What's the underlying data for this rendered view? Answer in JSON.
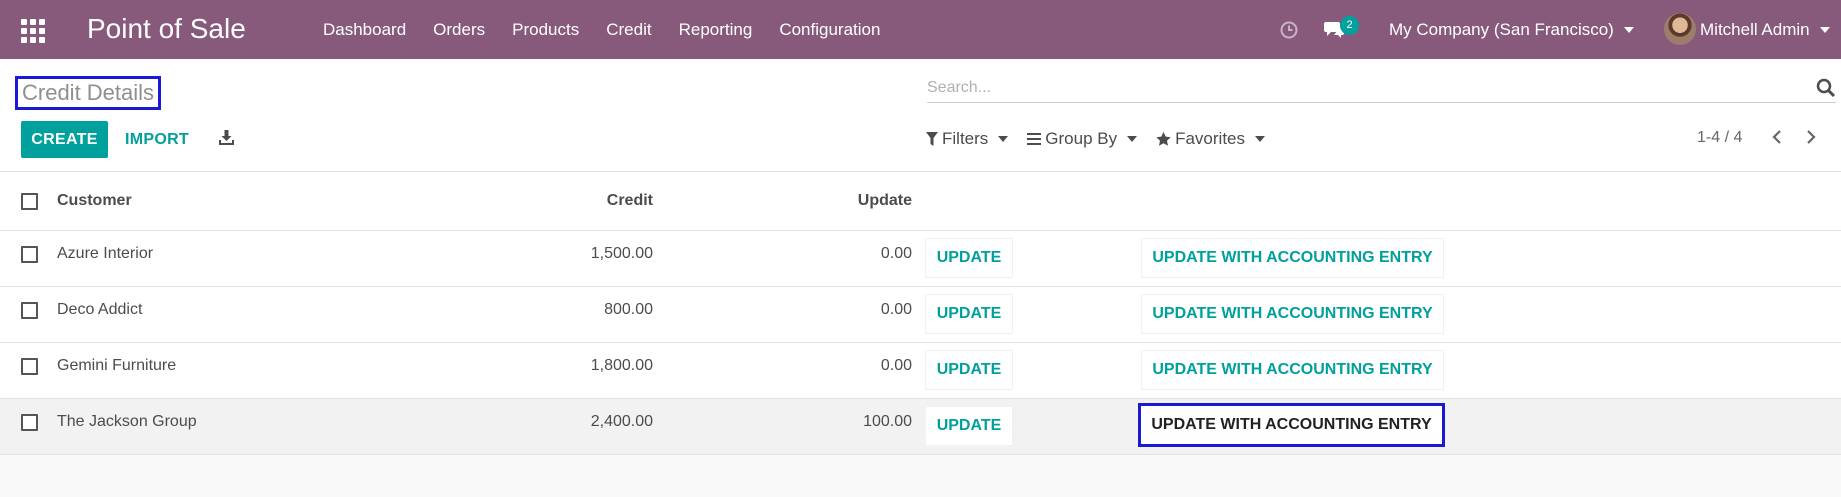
{
  "navbar": {
    "app_title": "Point of Sale",
    "menu": [
      "Dashboard",
      "Orders",
      "Products",
      "Credit",
      "Reporting",
      "Configuration"
    ],
    "chat_count": "2",
    "company": "My Company (San Francisco)",
    "user": "Mitchell Admin"
  },
  "control_panel": {
    "breadcrumb": "Credit Details",
    "search_placeholder": "Search...",
    "create_label": "CREATE",
    "import_label": "IMPORT",
    "filters_label": "Filters",
    "groupby_label": "Group By",
    "favorites_label": "Favorites",
    "pager": "1-4 / 4"
  },
  "table": {
    "headers": {
      "customer": "Customer",
      "credit": "Credit",
      "update": "Update"
    },
    "update_button": "UPDATE",
    "accounting_button": "UPDATE WITH ACCOUNTING ENTRY",
    "rows": [
      {
        "customer": "Azure Interior",
        "credit": "1,500.00",
        "update": "0.00"
      },
      {
        "customer": "Deco Addict",
        "credit": "800.00",
        "update": "0.00"
      },
      {
        "customer": "Gemini Furniture",
        "credit": "1,800.00",
        "update": "0.00"
      },
      {
        "customer": "The Jackson Group",
        "credit": "2,400.00",
        "update": "100.00"
      }
    ]
  },
  "colors": {
    "navbar": "#875a7b",
    "accent": "#00a09d",
    "highlight": "#1a1ad6"
  }
}
